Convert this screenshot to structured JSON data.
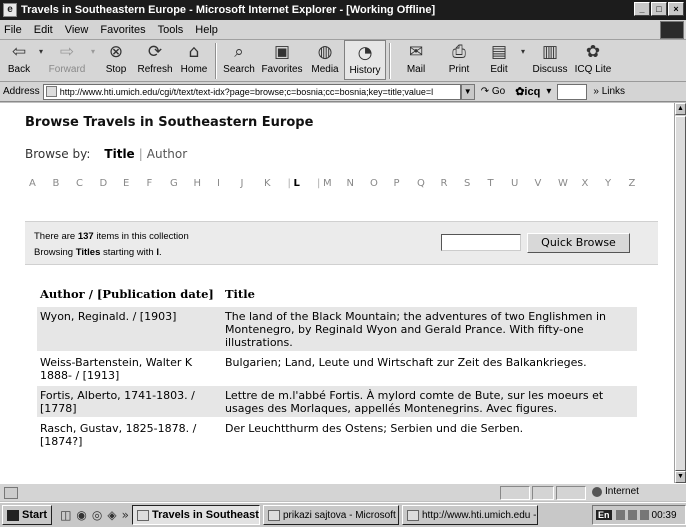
{
  "window": {
    "title": "Travels in Southeastern Europe - Microsoft Internet Explorer - [Working Offline]",
    "controls": [
      "_",
      "□",
      "×"
    ]
  },
  "menu": [
    "File",
    "Edit",
    "View",
    "Favorites",
    "Tools",
    "Help"
  ],
  "toolbar": {
    "back": "Back",
    "forward": "Forward",
    "stop": "Stop",
    "refresh": "Refresh",
    "home": "Home",
    "search": "Search",
    "favorites": "Favorites",
    "media": "Media",
    "history": "History",
    "mail": "Mail",
    "print": "Print",
    "edit": "Edit",
    "discuss": "Discuss",
    "icq_lite": "ICQ Lite"
  },
  "address": {
    "label": "Address",
    "url": "http://www.hti.umich.edu/cgi/t/text/text-idx?page=browse;c=bosnia;cc=bosnia;key=title;value=l",
    "go": "Go",
    "icq": "icq",
    "links": "Links"
  },
  "page": {
    "title": "Browse Travels in Southeastern Europe",
    "browse_by_label": "Browse by:",
    "browse_by_current": "Title",
    "browse_by_separator": "|",
    "browse_by_alt": "Author",
    "alphabet": [
      "A",
      "B",
      "C",
      "D",
      "E",
      "F",
      "G",
      "H",
      "I",
      "J",
      "K",
      "L",
      "M",
      "N",
      "O",
      "P",
      "Q",
      "R",
      "S",
      "T",
      "U",
      "V",
      "W",
      "X",
      "Y",
      "Z"
    ],
    "current_letter": "L",
    "info_prefix": "There are ",
    "info_count": "137",
    "info_suffix": " items in this collection",
    "browsing_prefix": "Browsing ",
    "browsing_field": "Titles",
    "browsing_mid": " starting with ",
    "browsing_letter": "l",
    "browsing_end": ".",
    "quick_browse": "Quick Browse",
    "col_author": "Author / [Publication date]",
    "col_title": "Title",
    "rows": [
      {
        "author": "Wyon, Reginald. / [1903]",
        "title": "The land of the Black Mountain; the adventures of two Englishmen in Montenegro, by Reginald Wyon and Gerald Prance. With fifty-one illustrations."
      },
      {
        "author": "Weiss-Bartenstein, Walter K 1888- / [1913]",
        "title": "Bulgarien; Land, Leute und Wirtschaft zur Zeit des Balkankrieges."
      },
      {
        "author": "Fortis, Alberto, 1741-1803. / [1778]",
        "title": "Lettre de m.l'abbé Fortis. À mylord comte de Bute, sur les moeurs et usages des Morlaques, appellés Montenegrins. Avec figures."
      },
      {
        "author": "Rasch, Gustav, 1825-1878. / [1874?]",
        "title": "Der Leuchtthurm des Ostens; Serbien und die Serben."
      }
    ]
  },
  "status": {
    "zone": "Internet"
  },
  "taskbar": {
    "start": "Start",
    "tasks": [
      "Travels in Southeast...",
      "prikazi sajtova - Microsoft ...",
      "http://www.hti.umich.edu -..."
    ],
    "lang": "En",
    "time": "00:39"
  }
}
